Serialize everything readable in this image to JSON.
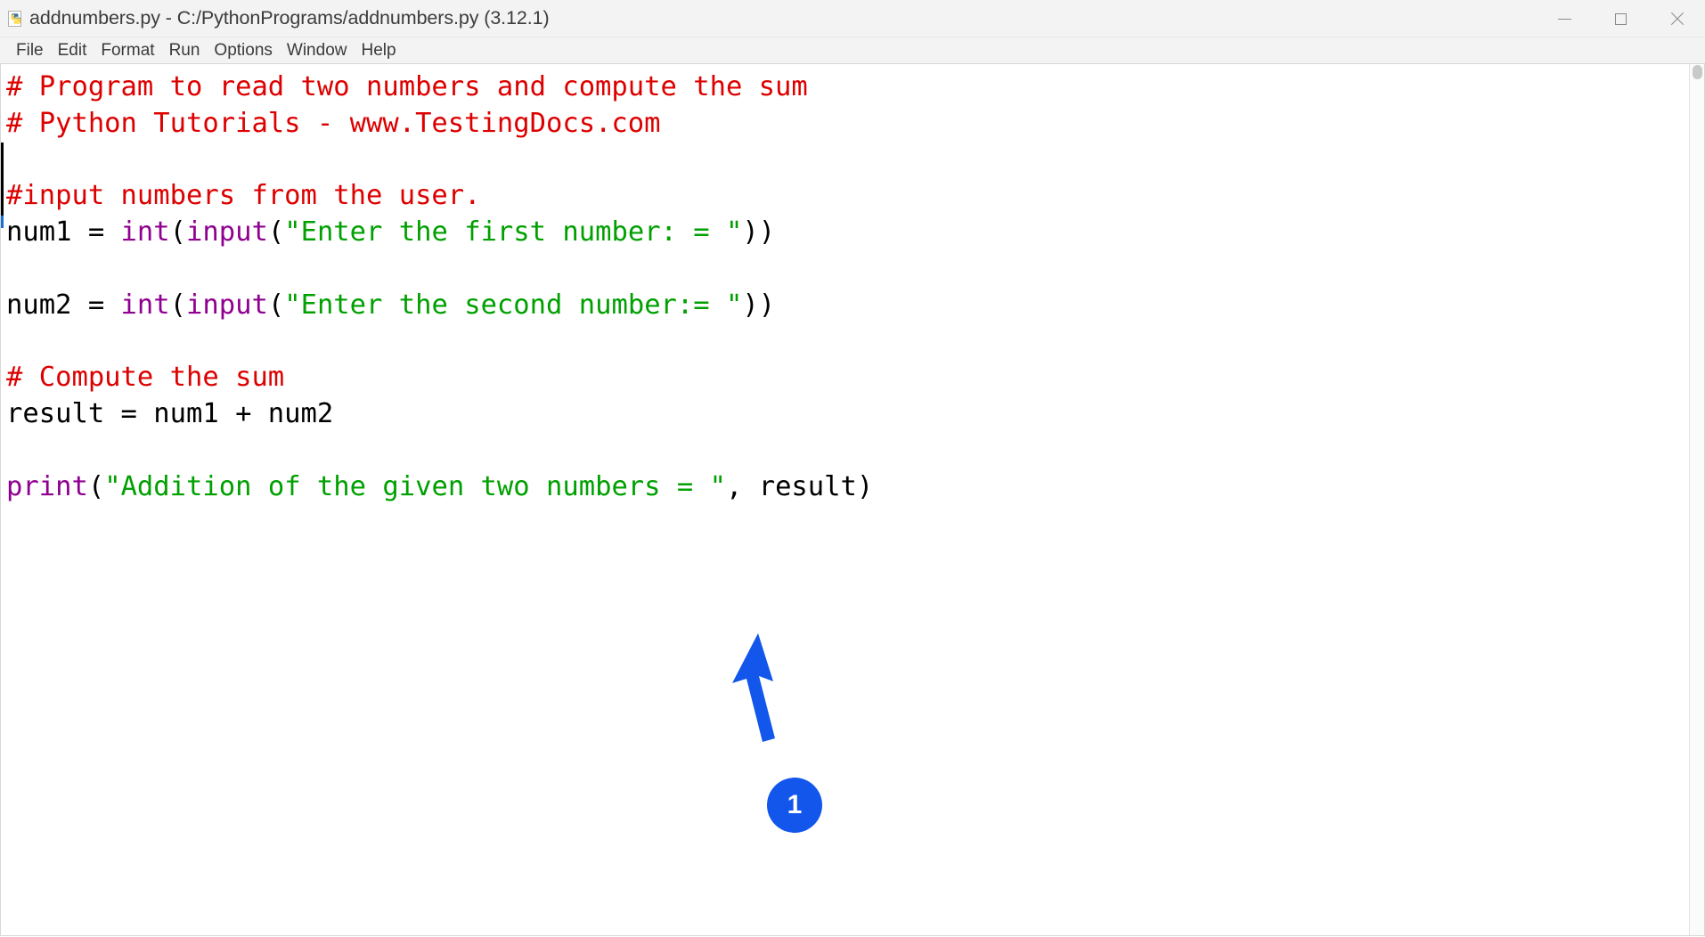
{
  "window": {
    "title": "addnumbers.py - C:/PythonPrograms/addnumbers.py (3.12.1)",
    "icon": "python-file-icon",
    "controls": {
      "minimize": "minimize-icon",
      "maximize": "maximize-icon",
      "close": "close-icon"
    }
  },
  "menubar": {
    "items": [
      {
        "label": "File"
      },
      {
        "label": "Edit"
      },
      {
        "label": "Format"
      },
      {
        "label": "Run"
      },
      {
        "label": "Options"
      },
      {
        "label": "Window"
      },
      {
        "label": "Help"
      }
    ]
  },
  "editor": {
    "lines": [
      {
        "id": 1,
        "tokens": [
          {
            "text": "# Program to read two numbers and compute the sum",
            "type": "comment"
          }
        ]
      },
      {
        "id": 2,
        "tokens": [
          {
            "text": "# Python Tutorials - www.TestingDocs.com",
            "type": "comment"
          }
        ]
      },
      {
        "id": 3,
        "tokens": [
          {
            "text": "",
            "type": "plain"
          }
        ]
      },
      {
        "id": 4,
        "tokens": [
          {
            "text": "#input numbers from the user.",
            "type": "comment"
          }
        ]
      },
      {
        "id": 5,
        "tokens": [
          {
            "text": "num1 = ",
            "type": "plain"
          },
          {
            "text": "int",
            "type": "builtin"
          },
          {
            "text": "(",
            "type": "plain"
          },
          {
            "text": "input",
            "type": "builtin"
          },
          {
            "text": "(",
            "type": "plain"
          },
          {
            "text": "\"Enter the first number: = \"",
            "type": "string"
          },
          {
            "text": "))",
            "type": "plain"
          }
        ]
      },
      {
        "id": 6,
        "tokens": [
          {
            "text": "",
            "type": "plain"
          }
        ]
      },
      {
        "id": 7,
        "tokens": [
          {
            "text": "num2 = ",
            "type": "plain"
          },
          {
            "text": "int",
            "type": "builtin"
          },
          {
            "text": "(",
            "type": "plain"
          },
          {
            "text": "input",
            "type": "builtin"
          },
          {
            "text": "(",
            "type": "plain"
          },
          {
            "text": "\"Enter the second number:= \"",
            "type": "string"
          },
          {
            "text": "))",
            "type": "plain"
          }
        ]
      },
      {
        "id": 8,
        "tokens": [
          {
            "text": "",
            "type": "plain"
          }
        ]
      },
      {
        "id": 9,
        "tokens": [
          {
            "text": "# Compute the sum",
            "type": "comment"
          }
        ]
      },
      {
        "id": 10,
        "tokens": [
          {
            "text": "result = num1 + num2",
            "type": "plain"
          }
        ]
      },
      {
        "id": 11,
        "tokens": [
          {
            "text": "",
            "type": "plain"
          }
        ]
      },
      {
        "id": 12,
        "tokens": [
          {
            "text": "print",
            "type": "builtin"
          },
          {
            "text": "(",
            "type": "plain"
          },
          {
            "text": "\"Addition of the given two numbers = \"",
            "type": "string"
          },
          {
            "text": ", result)",
            "type": "plain"
          }
        ]
      }
    ],
    "syntax_colors": {
      "comment": "#dd0000",
      "string": "#00a000",
      "builtin": "#900090",
      "plain": "#000000",
      "background": "#ffffff"
    }
  },
  "annotation": {
    "arrow": "up-arrow-annotation",
    "badge_label": "1",
    "color": "#1256ec"
  }
}
